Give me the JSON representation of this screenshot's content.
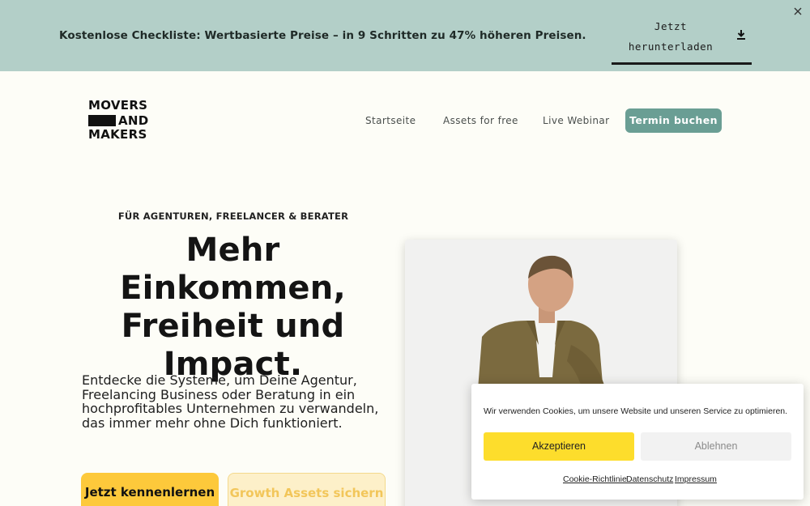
{
  "promo": {
    "text": "Kostenlose Checkliste: Wertbasierte Preise – in 9 Schritten zu 47% höheren Preisen.",
    "button_label": "Jetzt herunterladen",
    "download_icon": "download-icon",
    "close_icon": "close-icon"
  },
  "logo": {
    "line1": "MOVERS",
    "line2": "AND",
    "line3": "MAKERS"
  },
  "nav": {
    "items": [
      "Startseite",
      "Assets for free",
      "Live Webinar"
    ],
    "cta": "Termin buchen"
  },
  "hero": {
    "eyebrow": "FÜR AGENTUREN, FREELANCER & BERATER",
    "title": "Mehr Einkommen, Freiheit und Impact.",
    "subtitle": "Entdecke die Systeme, um Deine Agentur, Freelancing Business oder Beratung in ein hochprofitables Unternehmen zu verwandeln, das immer mehr ohne Dich funktioniert.",
    "primary_button": "Jetzt kennenlernen",
    "secondary_button": "Growth Assets sichern"
  },
  "cookie": {
    "text": "Wir verwenden Cookies, um unsere Website und unseren Service zu optimieren.",
    "accept": "Akzeptieren",
    "decline": "Ablehnen",
    "links": [
      "Cookie-Richtlinie",
      "Datenschutz",
      "Impressum"
    ]
  },
  "colors": {
    "promo_bg": "#b3cfc8",
    "page_bg": "#fdfdf7",
    "accent_green": "#6a9e94",
    "accent_yellow": "#fdc93b",
    "cookie_accept": "#fddd2c"
  }
}
